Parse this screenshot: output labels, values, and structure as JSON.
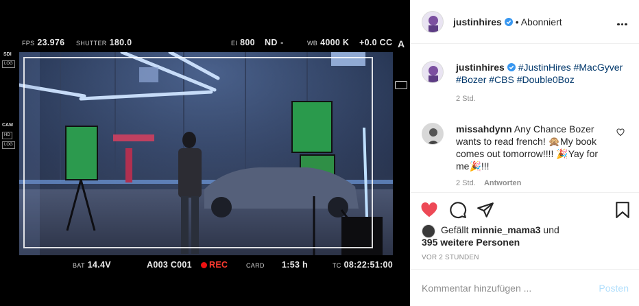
{
  "viewfinder": {
    "fps_label": "FPS",
    "fps_value": "23.976",
    "shutter_label": "SHUTTER",
    "shutter_value": "180.0",
    "ei_label": "EI",
    "ei_value": "800",
    "nd_label": "ND",
    "nd_value": "-",
    "wb_label": "WB",
    "wb_value": "4000 K",
    "cc_value": "+0.0 CC",
    "a_label": "A",
    "sdi_label": "SDI",
    "sdi_log": "LOG",
    "cam_label": "CAM",
    "cam_hd": "HD",
    "cam_log": "LOG",
    "bat_label": "BAT",
    "bat_value": "14.4V",
    "clip_value": "A003 C001",
    "rec_value": "REC",
    "card_label": "CARD",
    "card_value": "1:53 h",
    "tc_label": "TC",
    "tc_value": "08:22:51:00"
  },
  "post": {
    "username": "justinhires",
    "dot": "•",
    "follow_label": "Abonniert",
    "caption_user": "justinhires",
    "caption_tags": [
      "#JustinHires",
      "#MacGyver",
      "#Bozer",
      "#CBS",
      "#Double0Boz"
    ],
    "caption_time": "2 Std.",
    "comment": {
      "user": "missahdynn",
      "text": "Any Chance Bozer wants to read french! 🙊My book comes out tomorrow!!!! 🎉Yay for me🎉!!!",
      "time": "2 Std.",
      "reply_label": "Antworten"
    },
    "likes": {
      "prefix": "Gefällt",
      "user": "minnie_mama3",
      "and": "und",
      "others": "395 weitere Personen"
    },
    "timestamp": "VOR 2 STUNDEN",
    "comment_placeholder": "Kommentar hinzufügen ...",
    "post_button": "Posten"
  },
  "colors": {
    "like_red": "#ed4956",
    "verified_blue": "#3897f0",
    "hashtag": "#00376b",
    "muted": "#8e8e8e",
    "post_disabled": "#b2dffc"
  },
  "icons": [
    "more-options-icon",
    "verified-badge-icon",
    "heart-filled-icon",
    "comment-icon",
    "share-icon",
    "bookmark-icon",
    "small-heart-icon"
  ]
}
